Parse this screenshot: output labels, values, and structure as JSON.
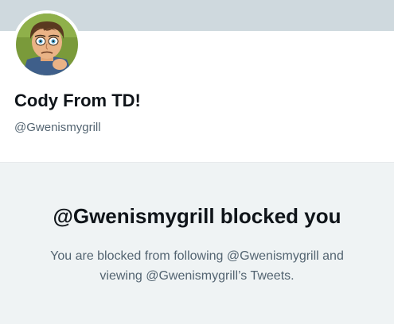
{
  "profile": {
    "name": "Cody From TD!",
    "handle": "@Gwenismygrill",
    "avatar_icon": "cartoon-character-avatar",
    "banner_color": "#cfd9de"
  },
  "blocked": {
    "title": "@Gwenismygrill blocked you",
    "message": "You are blocked from following @Gwenismygrill and viewing @Gwenismygrill’s Tweets."
  }
}
